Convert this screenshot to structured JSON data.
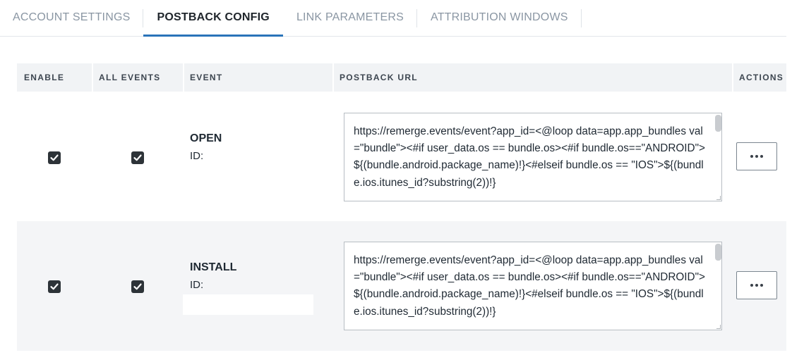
{
  "tabs": [
    {
      "label": "ACCOUNT SETTINGS",
      "active": false
    },
    {
      "label": "POSTBACK CONFIG",
      "active": true
    },
    {
      "label": "LINK PARAMETERS",
      "active": false
    },
    {
      "label": "ATTRIBUTION WINDOWS",
      "active": false
    }
  ],
  "table": {
    "headers": {
      "enable": "ENABLE",
      "all_events": "ALL EVENTS",
      "event": "EVENT",
      "postback_url": "POSTBACK URL",
      "actions": "ACTIONS"
    },
    "rows": [
      {
        "enabled": true,
        "all_events": true,
        "event_name": "OPEN",
        "id_label": "ID:",
        "postback_url": "https://remerge.events/event?app_id=<@loop data=app.app_bundles val=\"bundle\"><#if user_data.os == bundle.os><#if bundle.os==\"ANDROID\">${(bundle.android.package_name)!}<#elseif bundle.os == \"IOS\">${(bundle.ios.itunes_id?substring(2))!}"
      },
      {
        "enabled": true,
        "all_events": true,
        "event_name": "INSTALL",
        "id_label": "ID:",
        "postback_url": "https://remerge.events/event?app_id=<@loop data=app.app_bundles val=\"bundle\"><#if user_data.os == bundle.os><#if bundle.os==\"ANDROID\">${(bundle.android.package_name)!}<#elseif bundle.os == \"IOS\">${(bundle.ios.itunes_id?substring(2))!}"
      }
    ]
  },
  "icons": {
    "checkbox": "checkmark-icon",
    "actions": "more-horizontal-icon"
  },
  "colors": {
    "active_tab_underline": "#2a74b9",
    "header_background": "#f1f3f5",
    "alt_row_background": "#f4f5f7",
    "checkbox_fill": "#2d3338"
  }
}
